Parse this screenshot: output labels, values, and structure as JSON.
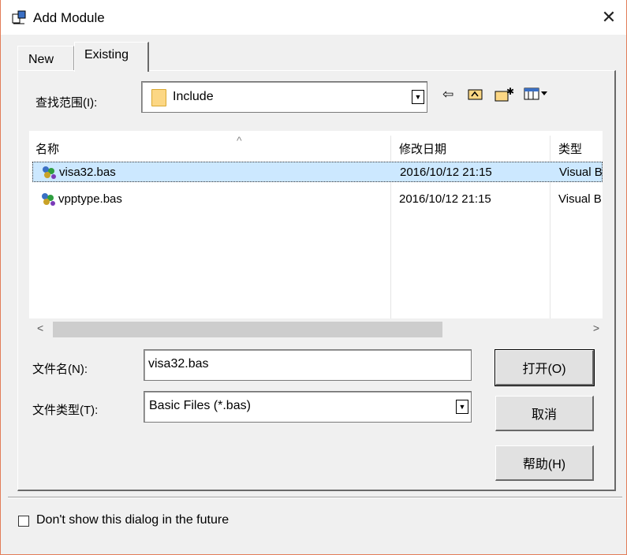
{
  "window": {
    "title": "Add Module",
    "close_glyph": "✕"
  },
  "tabs": [
    {
      "label": "New",
      "active": false
    },
    {
      "label": "Existing",
      "active": true
    }
  ],
  "lookin": {
    "label": "查找范围(I):",
    "value": "Include",
    "folder_icon": "folder-icon"
  },
  "toolbar": {
    "back_glyph": "⇦",
    "up_glyph": "⮤",
    "newfolder_glyph": "✱",
    "view_glyph": "▦▾",
    "icons": [
      "back-arrow-icon",
      "up-folder-icon",
      "new-folder-icon",
      "view-menu-icon"
    ]
  },
  "filelist": {
    "sort_caret": "^",
    "columns": [
      "名称",
      "修改日期",
      "类型"
    ],
    "rows": [
      {
        "name": "visa32.bas",
        "date": "2016/10/12 21:15",
        "type": "Visual B",
        "selected": true
      },
      {
        "name": "vpptype.bas",
        "date": "2016/10/12 21:15",
        "type": "Visual B",
        "selected": false
      }
    ],
    "scroll_left": "<",
    "scroll_right": ">"
  },
  "filename": {
    "label": "文件名(N):",
    "value": "visa32.bas"
  },
  "filetype": {
    "label": "文件类型(T):",
    "value": "Basic Files (*.bas)"
  },
  "buttons": {
    "open": "打开(O)",
    "cancel": "取消",
    "help": "帮助(H)"
  },
  "footer": {
    "checkbox_label": "Don't show this dialog in the future",
    "checked": false
  },
  "colors": {
    "selection": "#cce8ff",
    "accent_border": "#e27d58",
    "folder": "#fcd784"
  }
}
